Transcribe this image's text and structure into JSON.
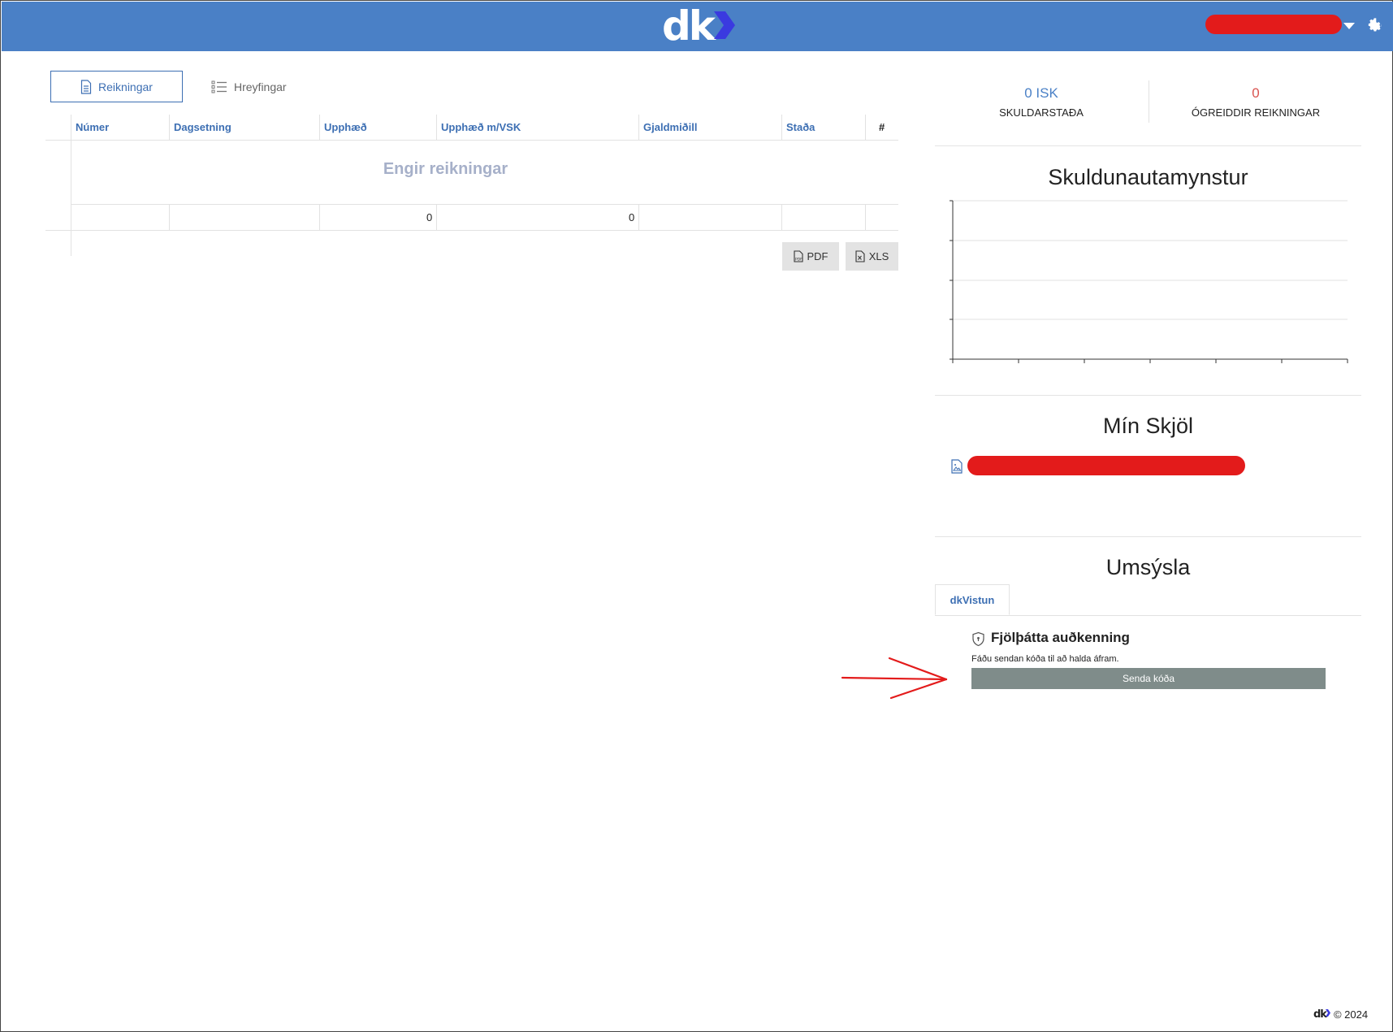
{
  "header": {
    "logo_text": "dk",
    "brand_color": "#4a80c6",
    "accent_color": "#3d6fb3"
  },
  "tabs": {
    "invoices": "Reikningar",
    "movements": "Hreyfingar"
  },
  "table": {
    "columns": [
      "Númer",
      "Dagsetning",
      "Upphæð",
      "Upphæð m/VSK",
      "Gjaldmiðill",
      "Staða",
      "#"
    ],
    "empty_message": "Engir reikningar",
    "totals": {
      "amount": "0",
      "amount_vat": "0"
    }
  },
  "export": {
    "pdf": "PDF",
    "xls": "XLS"
  },
  "stats": {
    "balance_value": "0 ISK",
    "balance_label": "SKULDARSTAÐA",
    "unpaid_value": "0",
    "unpaid_label": "ÓGREIDDIR REIKNINGAR"
  },
  "sections": {
    "debt_pattern": "Skuldunautamynstur",
    "my_documents": "Mín Skjöl",
    "management": "Umsýsla"
  },
  "management": {
    "tab_label": "dkVistun",
    "mfa_title": "Fjölþátta auðkenning",
    "mfa_text": "Fáðu sendan kóða til að halda áfram.",
    "send_button": "Senda kóða"
  },
  "footer": {
    "logo_text": "dk",
    "copyright": "© 2024"
  }
}
